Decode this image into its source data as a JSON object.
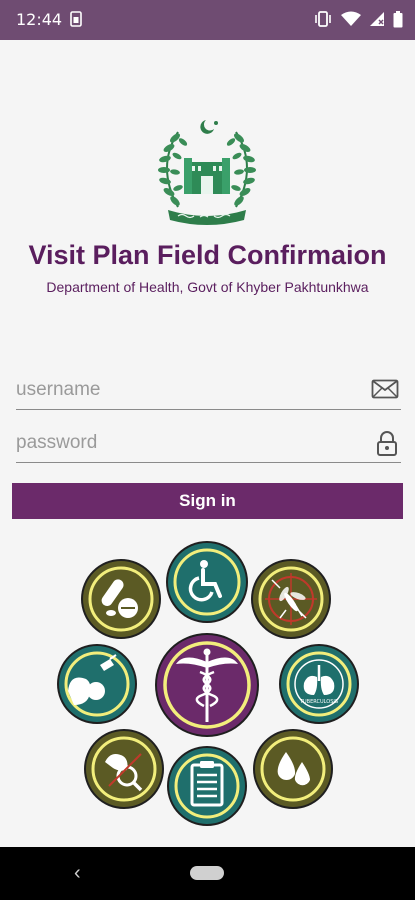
{
  "status_bar": {
    "time": "12:44"
  },
  "app": {
    "title": "Visit Plan Field Confirmaion",
    "subtitle": "Department of Health, Govt of Khyber Pakhtunkhwa"
  },
  "login": {
    "username_placeholder": "username",
    "password_placeholder": "password",
    "sign_in_label": "Sign in"
  },
  "badges": {
    "lungs_caption": "TUBERCULOSIS"
  },
  "colors": {
    "status_bar": "#6f4c72",
    "brand_purple": "#6b2a6a",
    "title_purple": "#5a1e5e",
    "olive": "#5b5a24",
    "teal": "#1f6f6c",
    "yellow_ring": "#f2ee7c"
  }
}
